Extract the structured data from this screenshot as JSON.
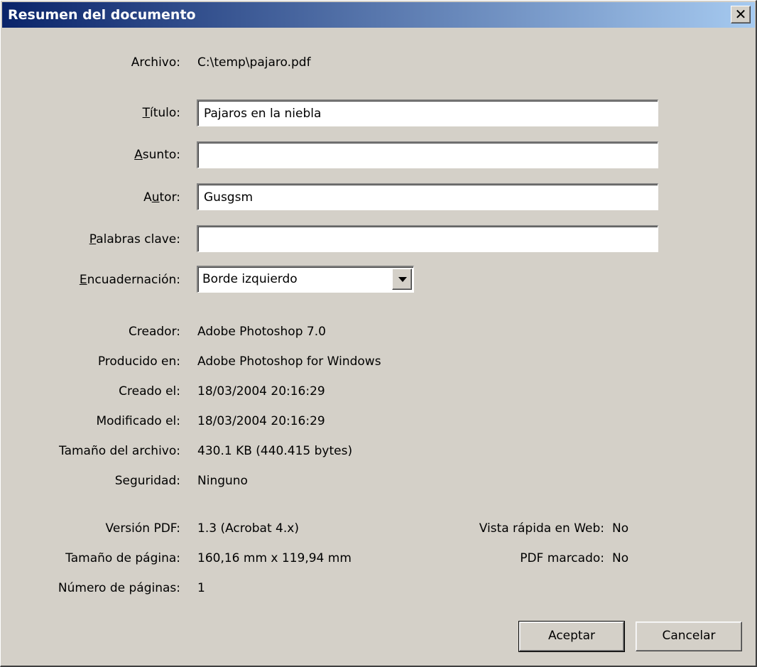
{
  "window": {
    "title": "Resumen del documento",
    "close_glyph": "✕"
  },
  "archivo": {
    "label": "Archivo:",
    "value": "C:\\temp\\pajaro.pdf"
  },
  "titulo": {
    "label_pre": "",
    "label_key": "T",
    "label_post": "ítulo:",
    "value": "Pajaros en la niebla"
  },
  "asunto": {
    "label_pre": "",
    "label_key": "A",
    "label_post": "sunto:",
    "value": ""
  },
  "autor": {
    "label_pre": "A",
    "label_key": "u",
    "label_post": "tor:",
    "value": "Gusgsm"
  },
  "palabras": {
    "label_pre": "",
    "label_key": "P",
    "label_post": "alabras clave:",
    "value": ""
  },
  "encuadernacion": {
    "label_pre": "",
    "label_key": "E",
    "label_post": "ncuadernación:",
    "value": "Borde izquierdo"
  },
  "info": [
    {
      "label": "Creador:",
      "value": "Adobe Photoshop 7.0"
    },
    {
      "label": "Producido en:",
      "value": "Adobe Photoshop for Windows"
    },
    {
      "label": "Creado el:",
      "value": "18/03/2004 20:16:29"
    },
    {
      "label": "Modificado el:",
      "value": "18/03/2004 20:16:29"
    },
    {
      "label": "Tamaño del archivo:",
      "value": "430.1 KB (440.415 bytes)"
    },
    {
      "label": "Seguridad:",
      "value": "Ninguno"
    }
  ],
  "pdf": [
    {
      "label": "Versión PDF:",
      "value": "1.3 (Acrobat 4.x)"
    },
    {
      "label": "Tamaño de página:",
      "value": "160,16 mm x 119,94 mm"
    },
    {
      "label": "Número de páginas:",
      "value": "1"
    }
  ],
  "pdf_right": [
    {
      "label": "Vista rápida en Web:",
      "value": "No"
    },
    {
      "label": "PDF marcado:",
      "value": "No"
    }
  ],
  "buttons": {
    "ok": "Aceptar",
    "cancel": "Cancelar"
  },
  "colors": {
    "titlebar_start": "#0a246a",
    "titlebar_end": "#a6caf0",
    "dialog_bg": "#d4d0c8"
  }
}
